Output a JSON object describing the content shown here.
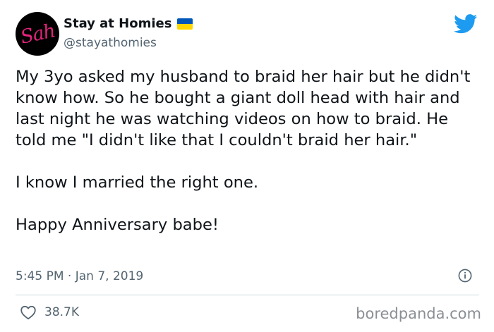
{
  "tweet": {
    "avatar_text": "Sah",
    "display_name": "Stay at Homies",
    "handle": "@stayathomies",
    "paragraphs": [
      "My 3yo asked my husband to braid her hair but he didn't know how. So he bought a giant doll head with hair and last night he was watching videos on how to braid. He told me \"I didn't like that I couldn't braid her hair.\"",
      "I know I married the right one.",
      "Happy Anniversary babe!"
    ],
    "timestamp": "5:45 PM · Jan 7, 2019",
    "likes": "38.7K"
  },
  "icons": {
    "verified_flag": "ukraine-flag-icon",
    "platform": "twitter-bird-icon",
    "info": "info-icon",
    "like": "heart-icon"
  },
  "watermark": "boredpanda.com",
  "colors": {
    "twitter_blue": "#1d9bf0",
    "flag_blue": "#0057b7",
    "flag_yellow": "#ffd700",
    "avatar_pink": "#e0247a",
    "secondary_text": "#536471"
  }
}
